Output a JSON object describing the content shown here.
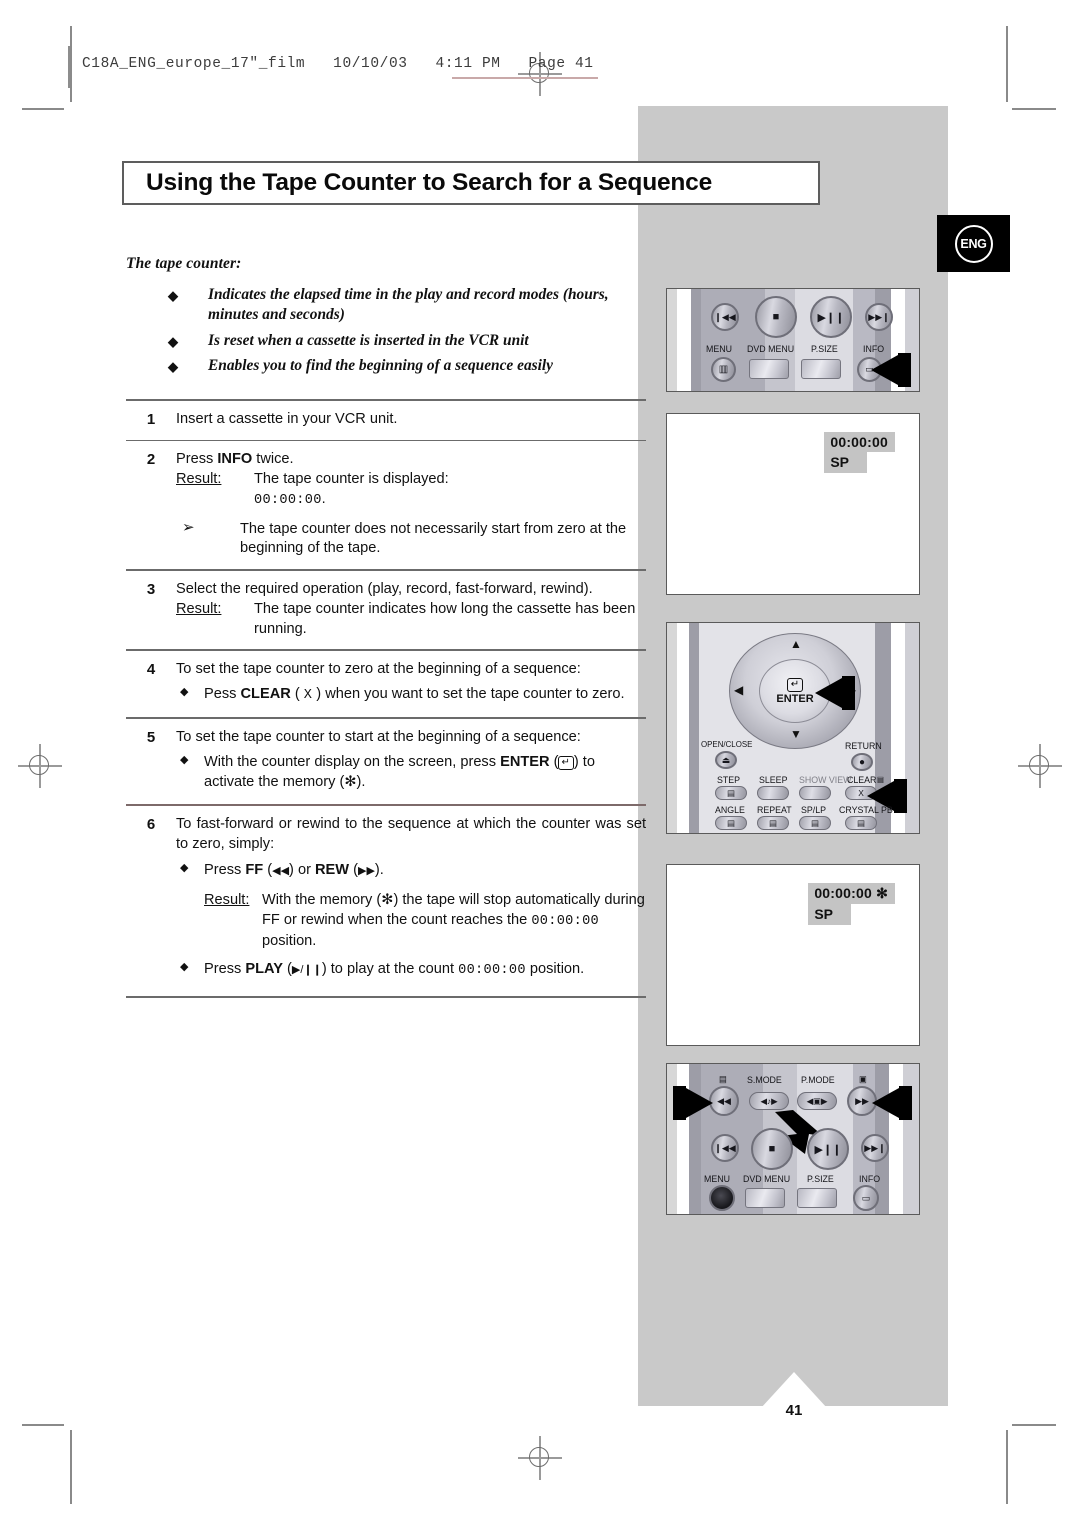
{
  "print_slug": {
    "text": "C18A_ENG_europe_17\"_film   10/10/03   4:11 PM   Page 41"
  },
  "language_badge": {
    "label": "ENG"
  },
  "title": "Using the Tape Counter to Search for a Sequence",
  "intro": {
    "lead": "The tape counter:",
    "bullets": [
      "Indicates the elapsed time in the play and record modes (hours, minutes and seconds)",
      "Is reset when a cassette is inserted in the VCR unit",
      "Enables you to find the beginning of a sequence easily"
    ]
  },
  "steps": [
    {
      "num": "1",
      "text": "Insert a cassette in your VCR unit."
    },
    {
      "num": "2",
      "text_pre": "Press ",
      "key": "INFO",
      "text_post": " twice.",
      "result_label": "Result:",
      "result_text": "The tape counter is displayed:",
      "result_value": "00:00:00",
      "result_value_suffix": ".",
      "note": "The tape counter does not necessarily start from zero at the beginning of the tape."
    },
    {
      "num": "3",
      "text": "Select the required operation (play, record, fast-forward, rewind).",
      "result_label": "Result:",
      "result_text": "The tape counter indicates how long the cassette has been running."
    },
    {
      "num": "4",
      "text": "To set the tape counter to zero at the beginning of a sequence:",
      "bullet_pre": "Pess ",
      "bullet_key": "CLEAR",
      "bullet_icon": "X",
      "bullet_post": " when you want to set the tape counter to zero."
    },
    {
      "num": "5",
      "text": "To set the tape counter to start at the beginning of a sequence:",
      "bullet_pre": "With the counter display on the screen, press ",
      "bullet_key": "ENTER",
      "bullet_icon": "enter-icon",
      "bullet_post": " to activate the memory (",
      "bullet_memory_icon": "✻",
      "bullet_end": ")."
    },
    {
      "num": "6",
      "text": "To fast-forward or rewind to the sequence at which the counter was set to zero, simply:",
      "bullet1_pre": "Press ",
      "bullet1_key1": "FF",
      "bullet1_icon1": "◀◀",
      "bullet1_mid": " or ",
      "bullet1_key2": "REW",
      "bullet1_icon2": "▶▶",
      "bullet1_end": ".",
      "result_label": "Result:",
      "result_a": "With the memory (",
      "result_mem": "✻",
      "result_b": ") the tape will stop automatically during FF or rewind when the count reaches the ",
      "result_value": "00:00:00",
      "result_c": " position.",
      "bullet2_pre": "Press ",
      "bullet2_key": "PLAY",
      "bullet2_icon": "▶/❙❙",
      "bullet2_mid": " to play at the count ",
      "bullet2_value": "00:00:00",
      "bullet2_end": " position."
    }
  ],
  "illustrations": {
    "remote_top": {
      "name": "remote-transport-row",
      "labels": [
        "MENU",
        "DVD MENU",
        "P.SIZE",
        "INFO"
      ],
      "button_icons": [
        "skip-back-icon",
        "stop-icon",
        "play-pause-icon",
        "skip-forward-icon"
      ],
      "pointer_target": "INFO"
    },
    "osd_counter": {
      "counter": "00:00:00",
      "mode": "SP"
    },
    "remote_nav": {
      "enter_label": "ENTER",
      "open_close": "OPEN/CLOSE",
      "return": "RETURN",
      "row1": [
        "STEP",
        "SLEEP",
        "SHOW VIEW",
        "CLEAR"
      ],
      "row2": [
        "ANGLE",
        "REPEAT",
        "SP/LP",
        "CRYSTAL PB"
      ],
      "clear_icon": "X",
      "pointer_targets": [
        "ENTER",
        "CLEAR"
      ]
    },
    "osd_counter_memory": {
      "counter": "00:00:00",
      "memory_icon": "✻",
      "mode": "SP"
    },
    "remote_bottom": {
      "top_labels": [
        "S.MODE",
        "P.MODE"
      ],
      "bottom_labels": [
        "MENU",
        "DVD MENU",
        "P.SIZE",
        "INFO"
      ],
      "pointer_targets": [
        "REW",
        "FF",
        "PLAY"
      ]
    }
  },
  "page_number": "41"
}
